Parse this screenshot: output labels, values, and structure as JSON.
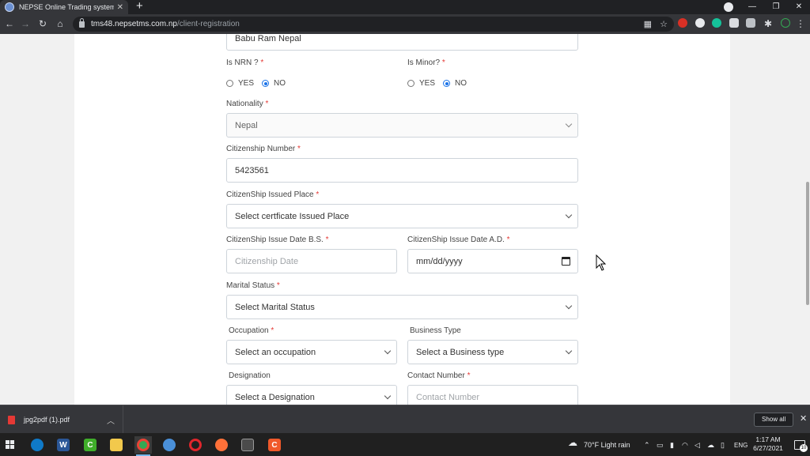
{
  "browser": {
    "tab_title": "NEPSE Online Trading system",
    "tab_close": "✕",
    "new_tab": "+",
    "url_host": "tms48.nepsetms.com.np",
    "url_path": "/client-registration",
    "window_minimize": "—",
    "window_restore": "❐",
    "window_close": "✕"
  },
  "form": {
    "name_value": "Babu Ram Nepal",
    "is_nrn": {
      "label": "Is NRN ?",
      "required": "*",
      "yes": "YES",
      "no": "NO",
      "selected": "NO"
    },
    "is_minor": {
      "label": "Is Minor?",
      "required": "*",
      "yes": "YES",
      "no": "NO",
      "selected": "NO"
    },
    "nationality": {
      "label": "Nationality",
      "required": "*",
      "value": "Nepal"
    },
    "citizenship_number": {
      "label": "Citizenship Number",
      "required": "*",
      "value": "5423561"
    },
    "issued_place": {
      "label": "CitizenShip Issued Place",
      "required": "*",
      "value": "Select certficate Issued Place"
    },
    "issue_date_bs": {
      "label": "CitizenShip Issue Date B.S.",
      "required": "*",
      "placeholder": "Citizenship Date"
    },
    "issue_date_ad": {
      "label": "CitizenShip Issue Date A.D.",
      "required": "*",
      "value": "mm/dd/yyyy"
    },
    "marital_status": {
      "label": "Marital Status",
      "required": "*",
      "value": "Select Marital Status"
    },
    "occupation": {
      "label": "Occupation",
      "required": "*",
      "value": "Select an occupation"
    },
    "business_type": {
      "label": "Business Type",
      "value": "Select a Business type"
    },
    "designation": {
      "label": "Designation",
      "value": "Select a Designation"
    },
    "contact_number": {
      "label": "Contact Number",
      "required": "*",
      "placeholder": "Contact Number"
    }
  },
  "downloads": {
    "file_name": "jpg2pdf (1).pdf",
    "show_all": "Show all",
    "close": "✕"
  },
  "taskbar": {
    "weather": "70°F  Light rain",
    "language": "ENG",
    "time": "1:17 AM",
    "date": "6/27/2021",
    "notification_count": "10"
  },
  "colors": {
    "required_marker": "#e53935",
    "radio_selected": "#1a73e8",
    "browser_dark": "#35363a"
  }
}
